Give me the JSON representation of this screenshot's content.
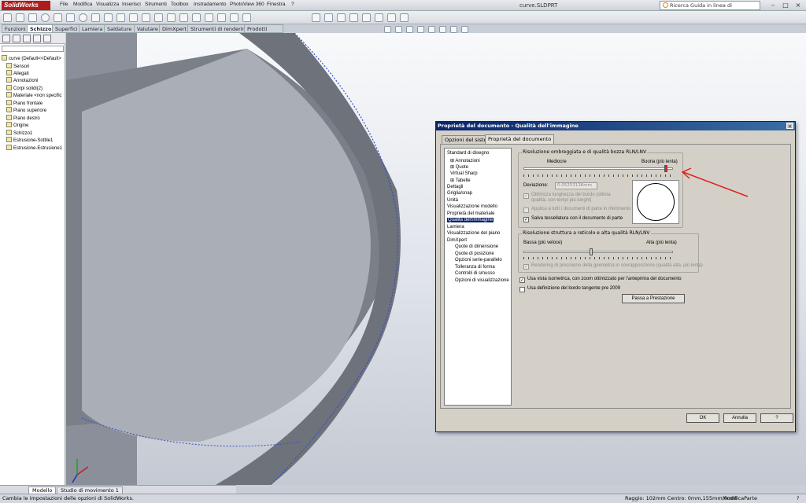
{
  "app": {
    "logo": "SolidWorks",
    "doc_title": "curve.SLDPRT"
  },
  "menu": [
    "File",
    "Modifica",
    "Visualizza",
    "Inserisci",
    "Strumenti",
    "Toolbox",
    "Instradamento",
    "PhotoView 360",
    "Finestra",
    "?"
  ],
  "search": {
    "placeholder": "Ricerca Guida in linea di SolidWorks"
  },
  "command_tabs": [
    "Funzioni",
    "Schizzo",
    "Superfici",
    "Lamiera",
    "Saldature",
    "Valutare",
    "DimXpert",
    "Strumenti di rendering",
    "Prodotti Office"
  ],
  "command_tabs_active": "Schizzo",
  "tree": {
    "root": "curve  (Default<<Default>",
    "items": [
      "Sensori",
      "Allegati",
      "Annotazioni",
      "Corpi solidi(2)",
      "Materiale <non specific",
      "Piano frontale",
      "Piano superiore",
      "Piano destro",
      "Origine",
      "Schizzo1",
      "Estrusione-Sottile1",
      "Estrusione-Estrusione1"
    ]
  },
  "bottom_tabs": [
    "Modello",
    "Studio di movimento 1"
  ],
  "status": {
    "left": "Cambia le impostazioni delle opzioni di SolidWorks.",
    "radius": "Raggio: 102mm  Centro: 0mm,155mm,0mm",
    "mode": "ModificaParte",
    "help": "?"
  },
  "dialog": {
    "title": "Proprietà del documento - Qualità dell'immagine",
    "close": "×",
    "tabs": [
      "Opzioni del sistema",
      "Proprietà del documento"
    ],
    "active_tab": "Proprietà del documento",
    "nav": [
      {
        "label": "Standard di disegno",
        "indent": 0
      },
      {
        "label": "Annotazioni",
        "indent": 1,
        "expand": "+"
      },
      {
        "label": "Quote",
        "indent": 1,
        "expand": "+"
      },
      {
        "label": "Virtual Sharp",
        "indent": 1
      },
      {
        "label": "Tabelle",
        "indent": 1,
        "expand": "+"
      },
      {
        "label": "Dettagli",
        "indent": 0
      },
      {
        "label": "Griglia/snap",
        "indent": 0
      },
      {
        "label": "Unità",
        "indent": 0
      },
      {
        "label": "Visualizzazione modello",
        "indent": 0
      },
      {
        "label": "Proprietà del materiale",
        "indent": 0
      },
      {
        "label": "Qualità dell'immagine",
        "indent": 0,
        "selected": true
      },
      {
        "label": "Lamiera",
        "indent": 0
      },
      {
        "label": "Visualizzazione del piano",
        "indent": 0
      },
      {
        "label": "DimXpert",
        "indent": 0
      },
      {
        "label": "Quote di dimensione",
        "indent": 2
      },
      {
        "label": "Quote di posizione",
        "indent": 2
      },
      {
        "label": "Opzioni serie-parallelo",
        "indent": 2
      },
      {
        "label": "Tolleranza di forma",
        "indent": 2
      },
      {
        "label": "Controlli di smusso",
        "indent": 2
      },
      {
        "label": "Opzioni di visualizzazione",
        "indent": 2
      }
    ],
    "shaded": {
      "group_label": "Risoluzione ombreggiata e di qualità bozza RLN/LNV",
      "low_label": "Mediocre",
      "high_label": "Buona (più lenta)",
      "slider_value": 0.95,
      "deviation_label": "Deviazione:",
      "deviation_value": "0.05253136mm",
      "opt_edge": "Ottimizza lunghezza del bordo (ottima qualità, con tempi più lunghi)",
      "opt_apply": "Applica a tutti i documenti di parte in riferimento",
      "opt_save": "Salva tessellatura con il documento di parte"
    },
    "wireframe": {
      "group_label": "Risoluzione struttura a reticolo e alta qualità RLN/LNV",
      "low_label": "Bassa (più veloce)",
      "high_label": "Alta (più lenta)",
      "slider_value": 0.45,
      "opt_precision": "Rendering di precisione della geometria in sovrapposizione (qualità alta, più lenta)"
    },
    "opt_isometric": "Usa vista isometrica, con zoom ottimizzato per l'anteprima del documento",
    "opt_tangent": "Usa definizione del bordo tangente pre 2009",
    "performance_button": "Passa a Prestazione",
    "ok": "OK",
    "cancel": "Annulla",
    "help": "?"
  },
  "colors": {
    "accent": "#0a246a",
    "annotation": "#e02020",
    "logo_red": "#b01c1c"
  }
}
